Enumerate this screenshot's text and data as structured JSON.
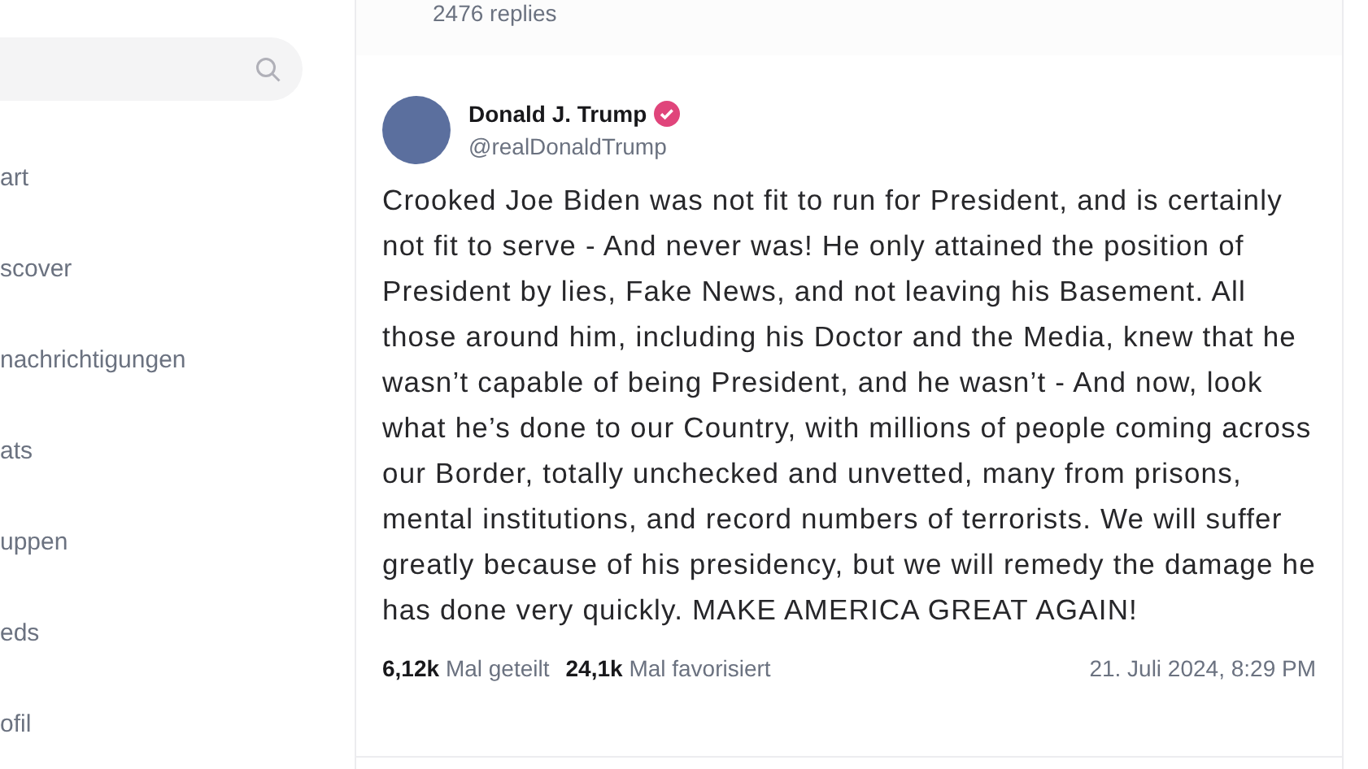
{
  "sidebar": {
    "items": [
      {
        "label": "art",
        "selected": false
      },
      {
        "label": "scover",
        "selected": false
      },
      {
        "label": "nachrichtigungen",
        "selected": false
      },
      {
        "label": "ats",
        "selected": false
      },
      {
        "label": "uppen",
        "selected": false
      },
      {
        "label": "eds",
        "selected": false
      },
      {
        "label": "ofil",
        "selected": false
      }
    ]
  },
  "previous_post": {
    "replies": "2476 replies"
  },
  "post": {
    "author": "Donald J. Trump",
    "verified": true,
    "handle": "@realDonaldTrump",
    "text": "Crooked Joe Biden was not fit to run for President, and is certainly not fit to serve - And never was! He only attained the position of President by lies, Fake News, and not leaving his Basement. All those around him, including his Doctor and the Media, knew that he wasn’t capable of being President, and he wasn’t - And now, look what he’s done to our Country, with millions of people coming across our Border, totally unchecked and unvetted, many from prisons, mental institutions, and record numbers of terrorists. We will suffer greatly because of his presidency, but we will remedy the damage he has done very quickly. MAKE AMERICA GREAT AGAIN!",
    "stats": [
      {
        "count": "6,12k",
        "label": "Mal geteilt"
      },
      {
        "count": "24,1k",
        "label": "Mal favorisiert"
      }
    ],
    "timestamp": "21. Juli 2024, 8:29 PM"
  }
}
